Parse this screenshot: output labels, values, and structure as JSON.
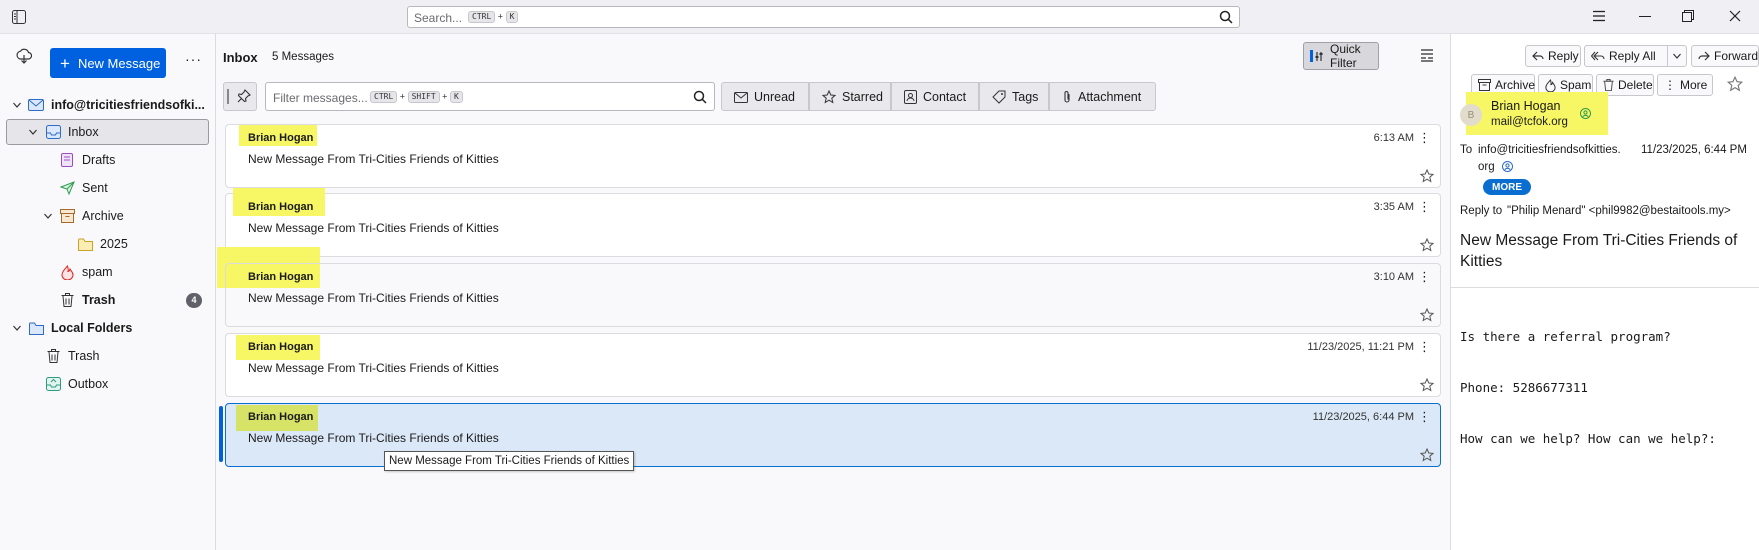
{
  "titlebar": {
    "search_placeholder": "Search...",
    "search_key1": "CTRL",
    "search_plus": "+",
    "search_key2": "K"
  },
  "folderpane": {
    "new_message_label": "New Message",
    "account": "info@tricitiesfriendsofki...",
    "folders": [
      {
        "label": "Inbox"
      },
      {
        "label": "Drafts"
      },
      {
        "label": "Sent"
      },
      {
        "label": "Archive"
      },
      {
        "label": "2025"
      },
      {
        "label": "spam"
      },
      {
        "label": "Trash",
        "count": "4"
      }
    ],
    "local_folders": "Local Folders",
    "local": [
      {
        "label": "Trash"
      },
      {
        "label": "Outbox"
      }
    ]
  },
  "list": {
    "folder_title": "Inbox",
    "message_count": "5 Messages",
    "quick_filter_label": "Quick Filter",
    "filter_placeholder": "Filter messages...",
    "filter_key1": "CTRL",
    "filter_key2": "SHIFT",
    "filter_key3": "K",
    "filter_plus": "+",
    "filters": [
      "Unread",
      "Starred",
      "Contact",
      "Tags",
      "Attachment"
    ],
    "messages": [
      {
        "sender": "Brian Hogan",
        "subject": "New Message From Tri-Cities Friends of Kitties",
        "date": "6:13 AM"
      },
      {
        "sender": "Brian Hogan",
        "subject": "New Message From Tri-Cities Friends of Kitties",
        "date": "3:35 AM"
      },
      {
        "sender": "Brian Hogan",
        "subject": "New Message From Tri-Cities Friends of Kitties",
        "date": "3:10 AM"
      },
      {
        "sender": "Brian Hogan",
        "subject": "New Message From Tri-Cities Friends of Kitties",
        "date": "11/23/2025, 11:21 PM"
      },
      {
        "sender": "Brian Hogan",
        "subject": "New Message From Tri-Cities Friends of Kitties",
        "date": "11/23/2025, 6:44 PM"
      }
    ],
    "tooltip": "New Message From Tri-Cities Friends of Kitties"
  },
  "reader": {
    "buttons": {
      "reply": "Reply",
      "reply_all": "Reply All",
      "forward": "Forward",
      "archive": "Archive",
      "spam": "Spam",
      "delete": "Delete",
      "more": "More"
    },
    "avatar_letter": "B",
    "from_name": "Brian Hogan",
    "from_email": "mail@tcfok.org",
    "to_label": "To",
    "to_value_1": "info@tricitiesfriendsofkitties.",
    "to_value_2": "org",
    "date": "11/23/2025, 6:44 PM",
    "more_badge": "MORE",
    "reply_to_label": "Reply to",
    "reply_to_value": "\"Philip Menard\" <phil9982@bestaitools.my>",
    "subject": "New Message From Tri-Cities Friends of Kitties",
    "body_line1": "Is there a referral program?",
    "body_line2": "Phone: 5286677311",
    "body_line3": "How can we help? How can we help?:"
  },
  "colors": {
    "accent": "#0061e0",
    "highlight": "#f7f766",
    "selected_row": "#dbe8f7"
  }
}
